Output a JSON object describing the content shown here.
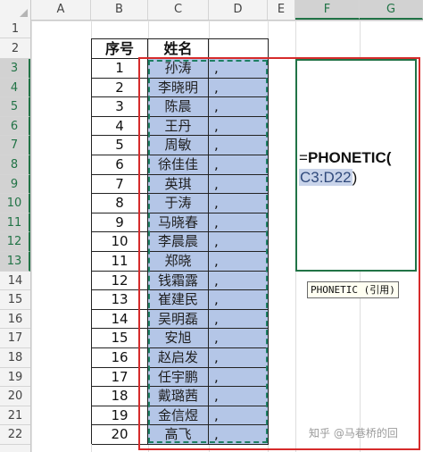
{
  "columns": [
    "A",
    "B",
    "C",
    "D",
    "E",
    "F",
    "G"
  ],
  "rows": [
    "1",
    "2",
    "3",
    "4",
    "5",
    "6",
    "7",
    "8",
    "9",
    "10",
    "11",
    "12",
    "13",
    "14",
    "15",
    "16",
    "17",
    "18",
    "19",
    "20",
    "21",
    "22"
  ],
  "table": {
    "header_no": "序号",
    "header_name": "姓名",
    "header_extra": "",
    "rows": [
      {
        "no": "1",
        "name": "孙涛",
        "comma": ","
      },
      {
        "no": "2",
        "name": "李晓明",
        "comma": ","
      },
      {
        "no": "3",
        "name": "陈晨",
        "comma": ","
      },
      {
        "no": "4",
        "name": "王丹",
        "comma": ","
      },
      {
        "no": "5",
        "name": "周敏",
        "comma": ","
      },
      {
        "no": "6",
        "name": "徐佳佳",
        "comma": ","
      },
      {
        "no": "7",
        "name": "英琪",
        "comma": ","
      },
      {
        "no": "8",
        "name": "于涛",
        "comma": ","
      },
      {
        "no": "9",
        "name": "马晓春",
        "comma": ","
      },
      {
        "no": "10",
        "name": "李晨晨",
        "comma": ","
      },
      {
        "no": "11",
        "name": "郑晓",
        "comma": ","
      },
      {
        "no": "12",
        "name": "钱霜露",
        "comma": ","
      },
      {
        "no": "13",
        "name": "崔建民",
        "comma": ","
      },
      {
        "no": "14",
        "name": "吴明磊",
        "comma": ","
      },
      {
        "no": "15",
        "name": "安旭",
        "comma": ","
      },
      {
        "no": "16",
        "name": "赵启发",
        "comma": ","
      },
      {
        "no": "17",
        "name": "任宇鹏",
        "comma": ","
      },
      {
        "no": "18",
        "name": "戴璐茜",
        "comma": ","
      },
      {
        "no": "19",
        "name": "金信煜",
        "comma": ","
      },
      {
        "no": "20",
        "name": "高飞",
        "comma": ","
      }
    ]
  },
  "formula": {
    "prefix": "=",
    "function": "PHONETIC(",
    "reference": "C3:D22",
    "suffix": ")"
  },
  "tooltip": "PHONETIC (引用)",
  "watermark": "知乎 @马巷桥的回",
  "colors": {
    "selection_fill": "#b4c6e7",
    "marquee": "#1d7f63",
    "highlight_box": "#d62b2b",
    "active_border": "#217346"
  }
}
